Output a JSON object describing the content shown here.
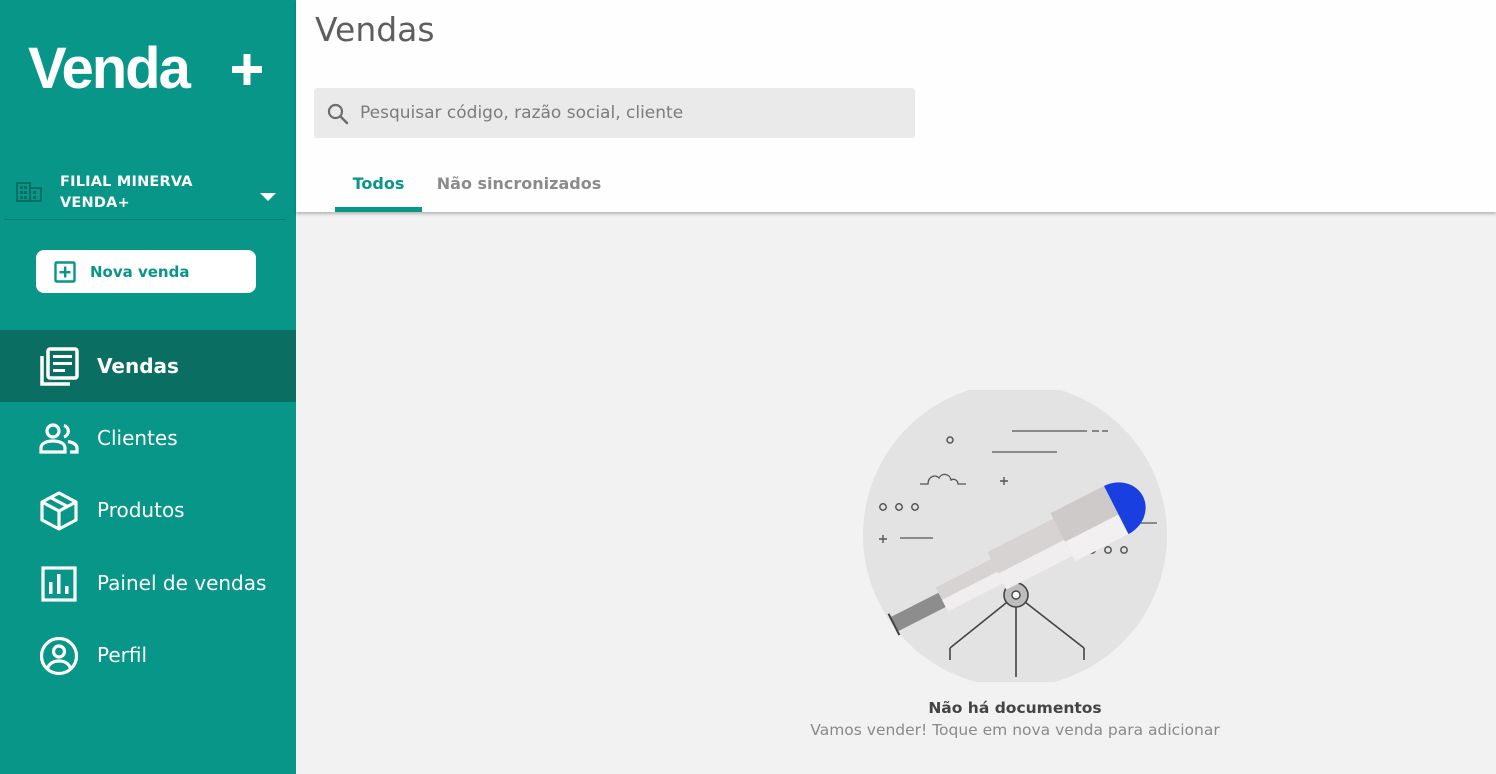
{
  "app": {
    "logo_text": "Venda+",
    "colors": {
      "primary": "#079688",
      "primary_dark": "#0b6e63",
      "telescope_accent": "#1a3fe0"
    }
  },
  "sidebar": {
    "branch": {
      "line1": "FILIAL MINERVA",
      "line2": "VENDA+",
      "icon": "building-icon"
    },
    "new_sale_label": "Nova venda",
    "items": [
      {
        "label": "Vendas",
        "icon": "receipt-list-icon",
        "active": true
      },
      {
        "label": "Clientes",
        "icon": "people-icon",
        "active": false
      },
      {
        "label": "Produtos",
        "icon": "box-icon",
        "active": false
      },
      {
        "label": "Painel de vendas",
        "icon": "bar-chart-icon",
        "active": false
      },
      {
        "label": "Perfil",
        "icon": "account-circle-icon",
        "active": false
      }
    ]
  },
  "main": {
    "title": "Vendas",
    "search": {
      "placeholder": "Pesquisar código, razão social, cliente",
      "value": ""
    },
    "tabs": [
      {
        "label": "Todos",
        "active": true
      },
      {
        "label": "Não sincronizados",
        "active": false
      }
    ],
    "empty_state": {
      "title": "Não há documentos",
      "subtitle": "Vamos vender! Toque em nova venda para adicionar",
      "illustration": "telescope-illustration"
    }
  }
}
